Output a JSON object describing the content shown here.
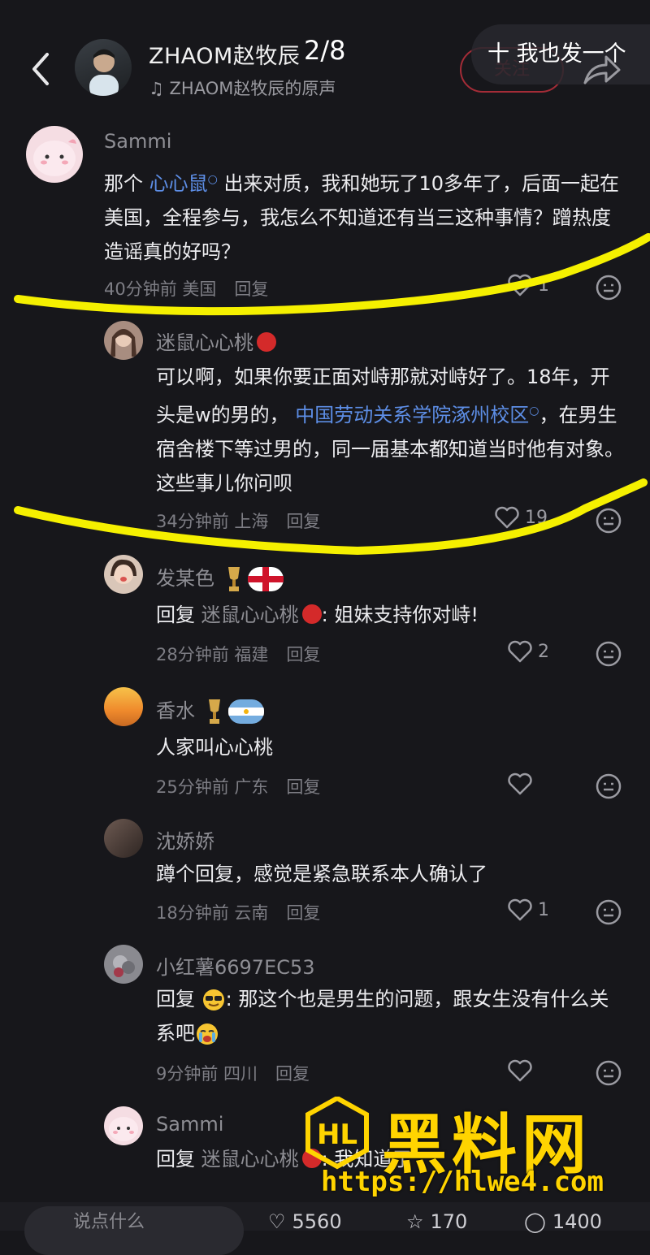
{
  "header": {
    "back_icon": "chevron-left-icon",
    "author_name": "ZHAOM赵牧辰",
    "page_indicator": "2/8",
    "music_text": "ZHAOM赵牧辰的原声",
    "follow_label": "关注",
    "also_post_label": "十 我也发一个"
  },
  "comments": [
    {
      "user": "Sammi",
      "text_before": "那个",
      "link": "心心鼠",
      "text_after": "出来对质，我和她玩了10多年了，后面一起在美国，全程参与，我怎么不知道还有当三这种事情？蹭热度造谣真的好吗？",
      "time": "40分钟前 美国",
      "reply": "回复",
      "likes": "1"
    },
    {
      "user": "迷鼠心心桃",
      "text_before": "可以啊，如果你要正面对峙那就对峙好了。18年，开头是w的男的，",
      "link": "中国劳动关系学院涿州校区",
      "text_after": "，在男生宿舍楼下等过男的，同一届基本都知道当时他有对象。这些事儿你问呗",
      "time": "34分钟前 上海",
      "reply": "回复",
      "likes": "19"
    },
    {
      "user": "发某色",
      "reply_prefix": "回复",
      "reply_to": "迷鼠心心桃",
      "text": ": 姐妹支持你对峙!",
      "time": "28分钟前 福建",
      "reply": "回复",
      "likes": "2"
    },
    {
      "user": "香水",
      "text": "人家叫心心桃",
      "time": "25分钟前 广东",
      "reply": "回复",
      "likes": ""
    },
    {
      "user": "沈娇娇",
      "text": "蹲个回复，感觉是紧急联系本人确认了",
      "time": "18分钟前 云南",
      "reply": "回复",
      "likes": "1"
    },
    {
      "user": "小红薯6697EC53",
      "reply_prefix": "回复",
      "text": ": 那这个也是男生的问题，跟女生没有什么关系吧",
      "time": "9分钟前 四川",
      "reply": "回复",
      "likes": ""
    },
    {
      "user": "Sammi",
      "reply_prefix": "回复",
      "reply_to": "迷鼠心心桃",
      "text": ": 我知道了"
    }
  ],
  "bottom": {
    "input_placeholder": "说点什么",
    "like_count": "5560",
    "collect_count": "170",
    "comment_count": "1400"
  },
  "watermark": {
    "title": "黑料网",
    "url": "https://hlwe4.com"
  },
  "colors": {
    "background": "#17171b",
    "link": "#5d8ee6",
    "highlight": "#f5f000",
    "follow": "#c8323f",
    "watermark": "#ffd400"
  }
}
